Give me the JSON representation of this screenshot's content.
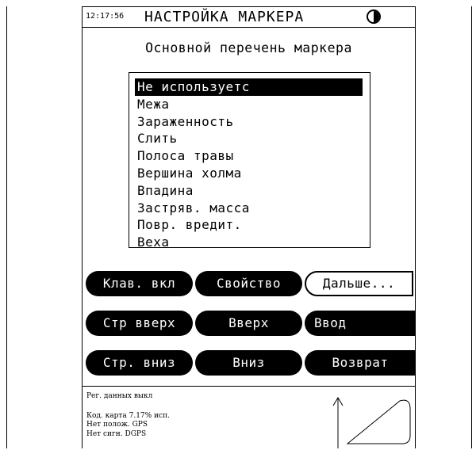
{
  "titlebar": {
    "time": "12:17:56",
    "title": "НАСТРОЙКА МАРКЕРА",
    "icon": "contrast-icon"
  },
  "heading": "Основной перечень маркера",
  "marker_list": {
    "items": [
      "Не используетс",
      "Межа",
      "Зараженность",
      "Слить",
      "Полоса травы",
      "Вершина холма",
      "Впадина",
      "Застряв. масса",
      "Повр. вредит.",
      "Веха"
    ],
    "selected": "Не используетс"
  },
  "buttons": {
    "keyboard": "Клав. вкл",
    "property": "Свойство",
    "more": "Дальше...",
    "page_up": "Стр вверх",
    "up": "Вверх",
    "enter": "Ввод",
    "page_down": "Стр. вниз",
    "down": "Вниз",
    "back": "Возврат"
  },
  "status": {
    "data_reg": "Рег. данных выкл",
    "map_code": "Код. карта  7.17% исп.",
    "no_position": "Нет полож. GPS",
    "no_signal": "Нет сигн. DGPS"
  },
  "icons": {
    "north_arrow": "arrow-up-icon",
    "field_outline": "field-shape-icon"
  }
}
